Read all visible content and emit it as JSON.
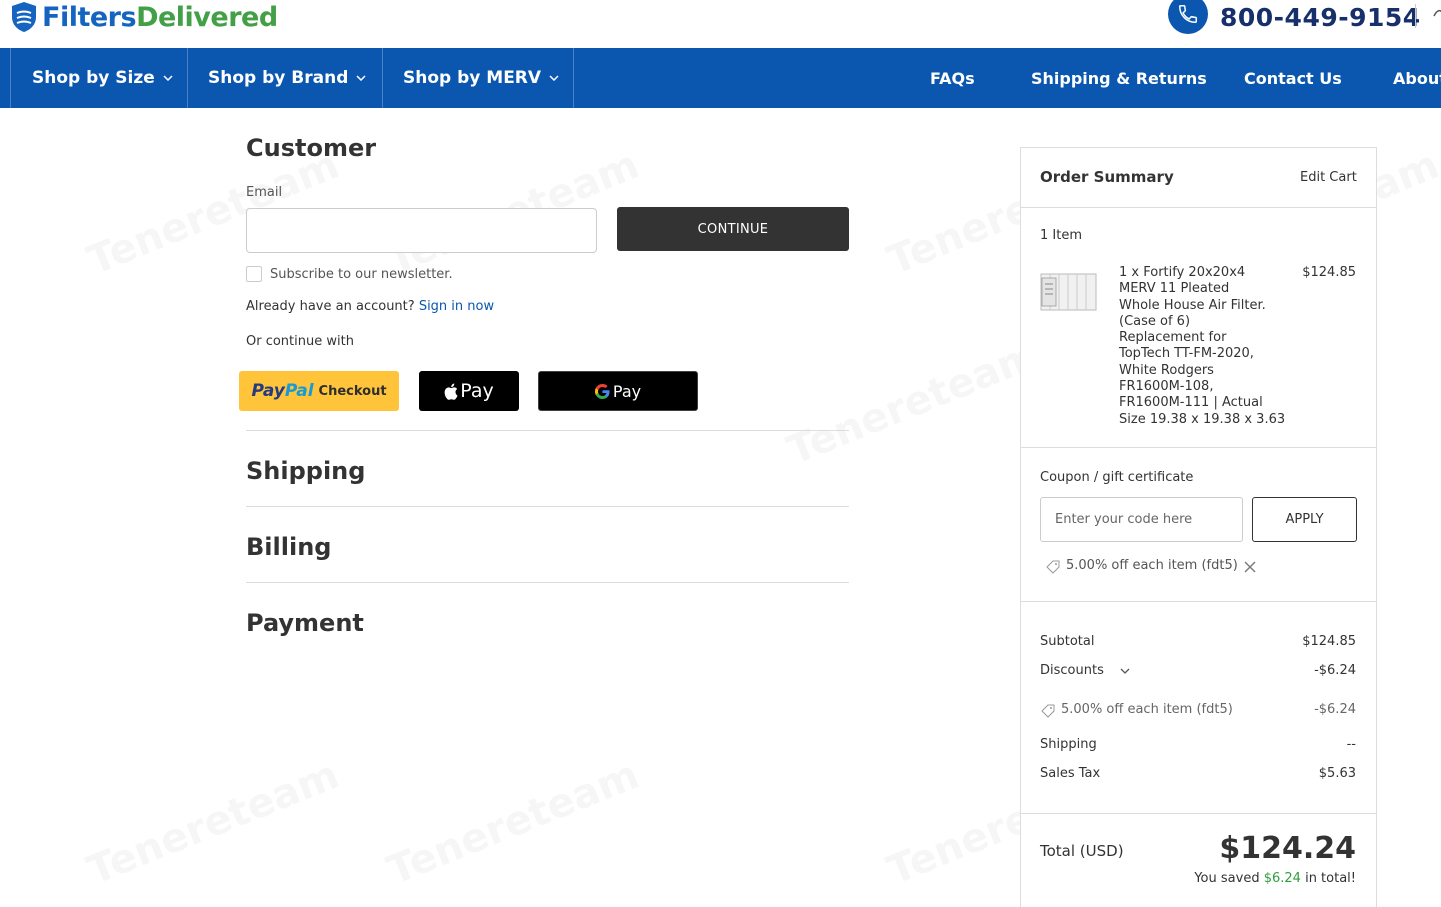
{
  "header": {
    "logo_part1": "Filters",
    "logo_part2": "Delivered",
    "phone": "800-449-9154"
  },
  "nav": {
    "shop_by_size": "Shop by Size",
    "shop_by_brand": "Shop by Brand",
    "shop_by_merv": "Shop by MERV",
    "faqs": "FAQs",
    "shipping_returns": "Shipping & Returns",
    "contact_us": "Contact Us",
    "about": "About"
  },
  "checkout": {
    "customer_heading": "Customer",
    "email_label": "Email",
    "email_value": "",
    "continue_label": "CONTINUE",
    "newsletter_label": "Subscribe to our newsletter.",
    "have_account_text": "Already have an account?",
    "sign_in_link": "Sign in now",
    "or_continue": "Or continue with",
    "paypal_pay": "Pay",
    "paypal_pal": "Pal",
    "paypal_checkout": "Checkout",
    "applepay_label": "Pay",
    "gpay_label": "Pay",
    "shipping_heading": "Shipping",
    "billing_heading": "Billing",
    "payment_heading": "Payment"
  },
  "summary": {
    "title": "Order Summary",
    "edit_cart": "Edit Cart",
    "item_count": "1 Item",
    "product_lines": [
      "1 x Fortify 20x20x4",
      "MERV 11 Pleated",
      "Whole House Air Filter.",
      "(Case of 6)",
      "Replacement for",
      "TopTech TT-FM-2020,",
      "White Rodgers",
      "FR1600M-108,",
      "FR1600M-111 | Actual",
      "Size 19.38 x 19.38 x 3.63"
    ],
    "product_price": "$124.85",
    "coupon_link": "Coupon / gift certificate",
    "coupon_placeholder": "Enter your code here",
    "apply_label": "APPLY",
    "applied_coupon": "5.00% off each item (fdt5)",
    "subtotal_label": "Subtotal",
    "subtotal_value": "$124.85",
    "discounts_label": "Discounts",
    "discounts_value": "-$6.24",
    "discount_line_label": "5.00% off each item (fdt5)",
    "discount_line_value": "-$6.24",
    "shipping_label": "Shipping",
    "shipping_value": "--",
    "tax_label": "Sales Tax",
    "tax_value": "$5.63",
    "total_label": "Total (USD)",
    "total_value": "$124.24",
    "saved_prefix": "You saved",
    "saved_amount": "$6.24",
    "saved_suffix": "in total!"
  },
  "colors": {
    "nav_blue": "#0b57b0",
    "brand_green": "#43a047",
    "button_dark": "#333333",
    "paypal_yellow": "#ffc439",
    "saved_green": "#2e9e3c"
  }
}
